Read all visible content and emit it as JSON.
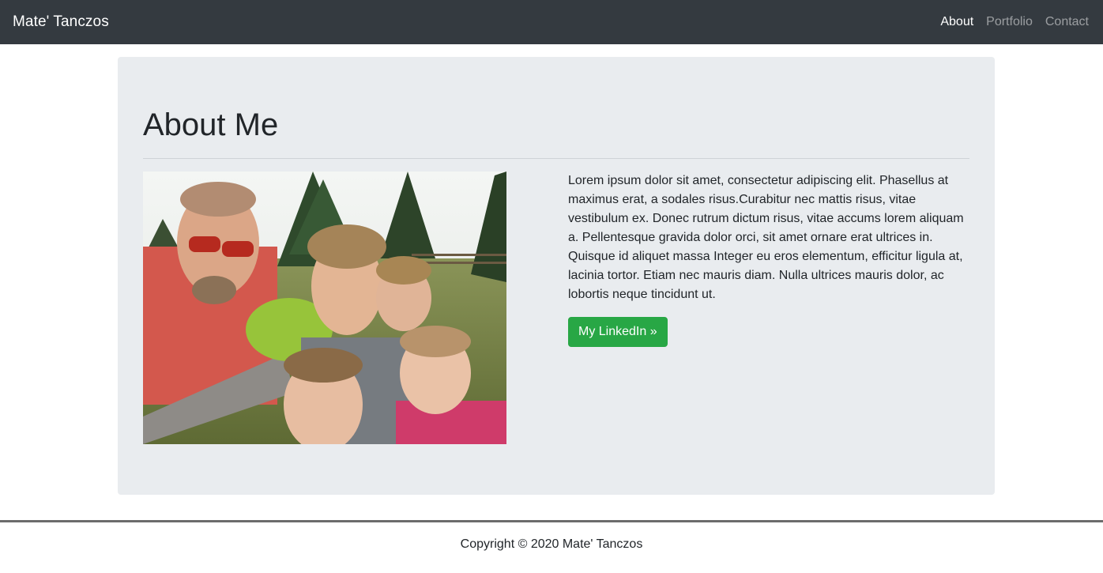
{
  "navbar": {
    "brand": "Mate' Tanczos",
    "links": [
      {
        "label": "About",
        "active": true
      },
      {
        "label": "Portfolio",
        "active": false
      },
      {
        "label": "Contact",
        "active": false
      }
    ]
  },
  "about": {
    "heading": "About Me",
    "photo_alt": "Family selfie outdoors",
    "bio": "Lorem ipsum dolor sit amet, consectetur adipiscing elit. Phasellus at maximus erat, a sodales risus.Curabitur nec mattis risus, vitae vestibulum ex. Donec rutrum dictum risus, vitae accums lorem aliquam a. Pellentesque gravida dolor orci, sit amet ornare erat ultrices in. Quisque id aliquet massa Integer eu eros elementum, efficitur ligula at, lacinia tortor. Etiam nec mauris diam. Nulla ultrices mauris dolor, ac lobortis neque tincidunt ut.",
    "linkedin_button": "My LinkedIn »"
  },
  "footer": {
    "copyright": "Copyright © 2020 Mate' Tanczos"
  },
  "colors": {
    "navbar_bg": "#343a40",
    "jumbotron_bg": "#e9ecef",
    "button_green": "#28a745"
  }
}
